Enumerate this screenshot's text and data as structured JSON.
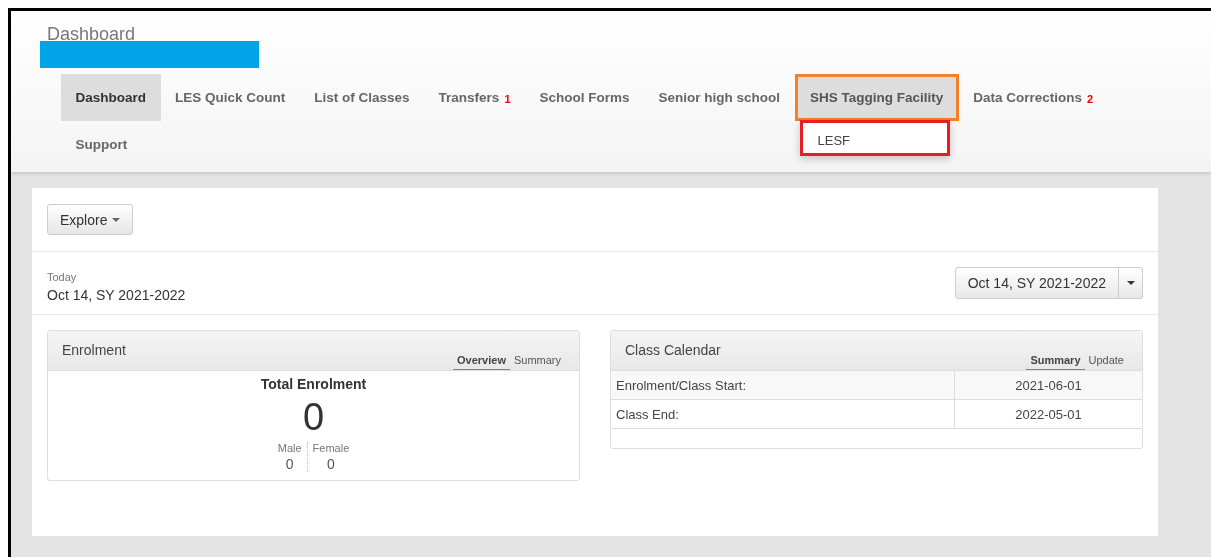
{
  "header": {
    "title": "Dashboard"
  },
  "nav": [
    {
      "label": "Dashboard",
      "selected": true,
      "open": false,
      "highlighted": false
    },
    {
      "label": "LES Quick Count",
      "selected": false,
      "open": false,
      "highlighted": false
    },
    {
      "label": "List of Classes",
      "selected": false,
      "open": false,
      "highlighted": false
    },
    {
      "label": "Transfers",
      "badge": "1",
      "selected": false,
      "open": false,
      "highlighted": false
    },
    {
      "label": "School Forms",
      "selected": false,
      "open": false,
      "highlighted": false
    },
    {
      "label": "Senior high school",
      "selected": false,
      "open": false,
      "highlighted": false
    },
    {
      "label": "SHS Tagging Facility",
      "selected": false,
      "open": true,
      "highlighted": true,
      "menu": [
        {
          "label": "LESF",
          "highlighted": true
        }
      ]
    },
    {
      "label": "Data Corrections",
      "badge": "2",
      "selected": false,
      "open": false,
      "highlighted": false
    },
    {
      "label": "Support",
      "selected": false,
      "open": false,
      "highlighted": false
    }
  ],
  "toolbar": {
    "explore_button": "Explore"
  },
  "date": {
    "label": "Today",
    "value": "Oct 14, SY 2021-2022",
    "picker": "Oct 14, SY 2021-2022"
  },
  "enrolment": {
    "title": "Enrolment",
    "tabs": [
      {
        "label": "Overview",
        "selected": true
      },
      {
        "label": "Summary",
        "selected": false
      }
    ],
    "heading": "Total Enrolment",
    "total": "0",
    "breakdown": [
      {
        "label": "Male",
        "value": "0"
      },
      {
        "label": "Female",
        "value": "0"
      }
    ]
  },
  "calendar": {
    "title": "Class Calendar",
    "tabs": [
      {
        "label": "Summary",
        "selected": true
      },
      {
        "label": "Update",
        "selected": false
      }
    ],
    "rows": [
      {
        "label": "Enrolment/Class Start:",
        "value": "2021-06-01"
      },
      {
        "label": "Class End:",
        "value": "2022-05-01"
      }
    ]
  }
}
